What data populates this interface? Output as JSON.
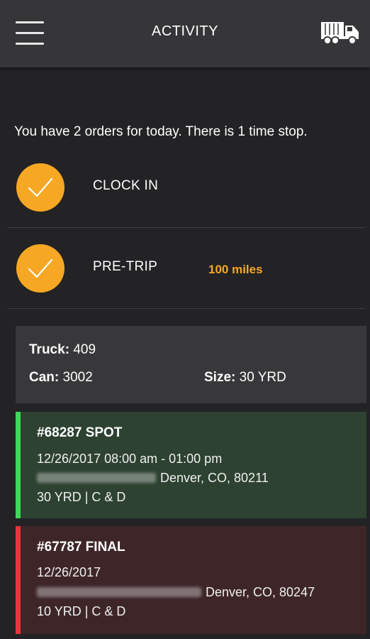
{
  "header": {
    "title": "ACTIVITY",
    "menu_icon": "hamburger-menu-icon",
    "right_icon": "truck-icon"
  },
  "summary": "You have 2 orders for today. There is 1 time stop.",
  "steps": [
    {
      "label": "CLOCK IN",
      "completed": true,
      "icon": "check-icon"
    },
    {
      "label": "PRE-TRIP",
      "completed": true,
      "icon": "check-icon",
      "extra": "100 miles"
    }
  ],
  "truck_info": {
    "truck_label": "Truck:",
    "truck_value": "409",
    "can_label": "Can:",
    "can_value": "3002",
    "size_label": "Size:",
    "size_value": "30 YRD"
  },
  "orders": [
    {
      "title": "#68287 SPOT",
      "time": "12/26/2017 08:00 am - 01:00 pm",
      "address_city": "Denver, CO, 80211",
      "details": "30 YRD | C & D",
      "status_color": "#40d75a"
    },
    {
      "title": "#67787 FINAL",
      "time": "12/26/2017",
      "address_city": "Denver, CO, 80247",
      "details": "10 YRD | C & D",
      "status_color": "#e8343c"
    }
  ],
  "colors": {
    "accent": "#f6a824",
    "background": "#232325",
    "header": "#363638",
    "spot_card": "#2d4231",
    "final_card": "#3e2628"
  }
}
